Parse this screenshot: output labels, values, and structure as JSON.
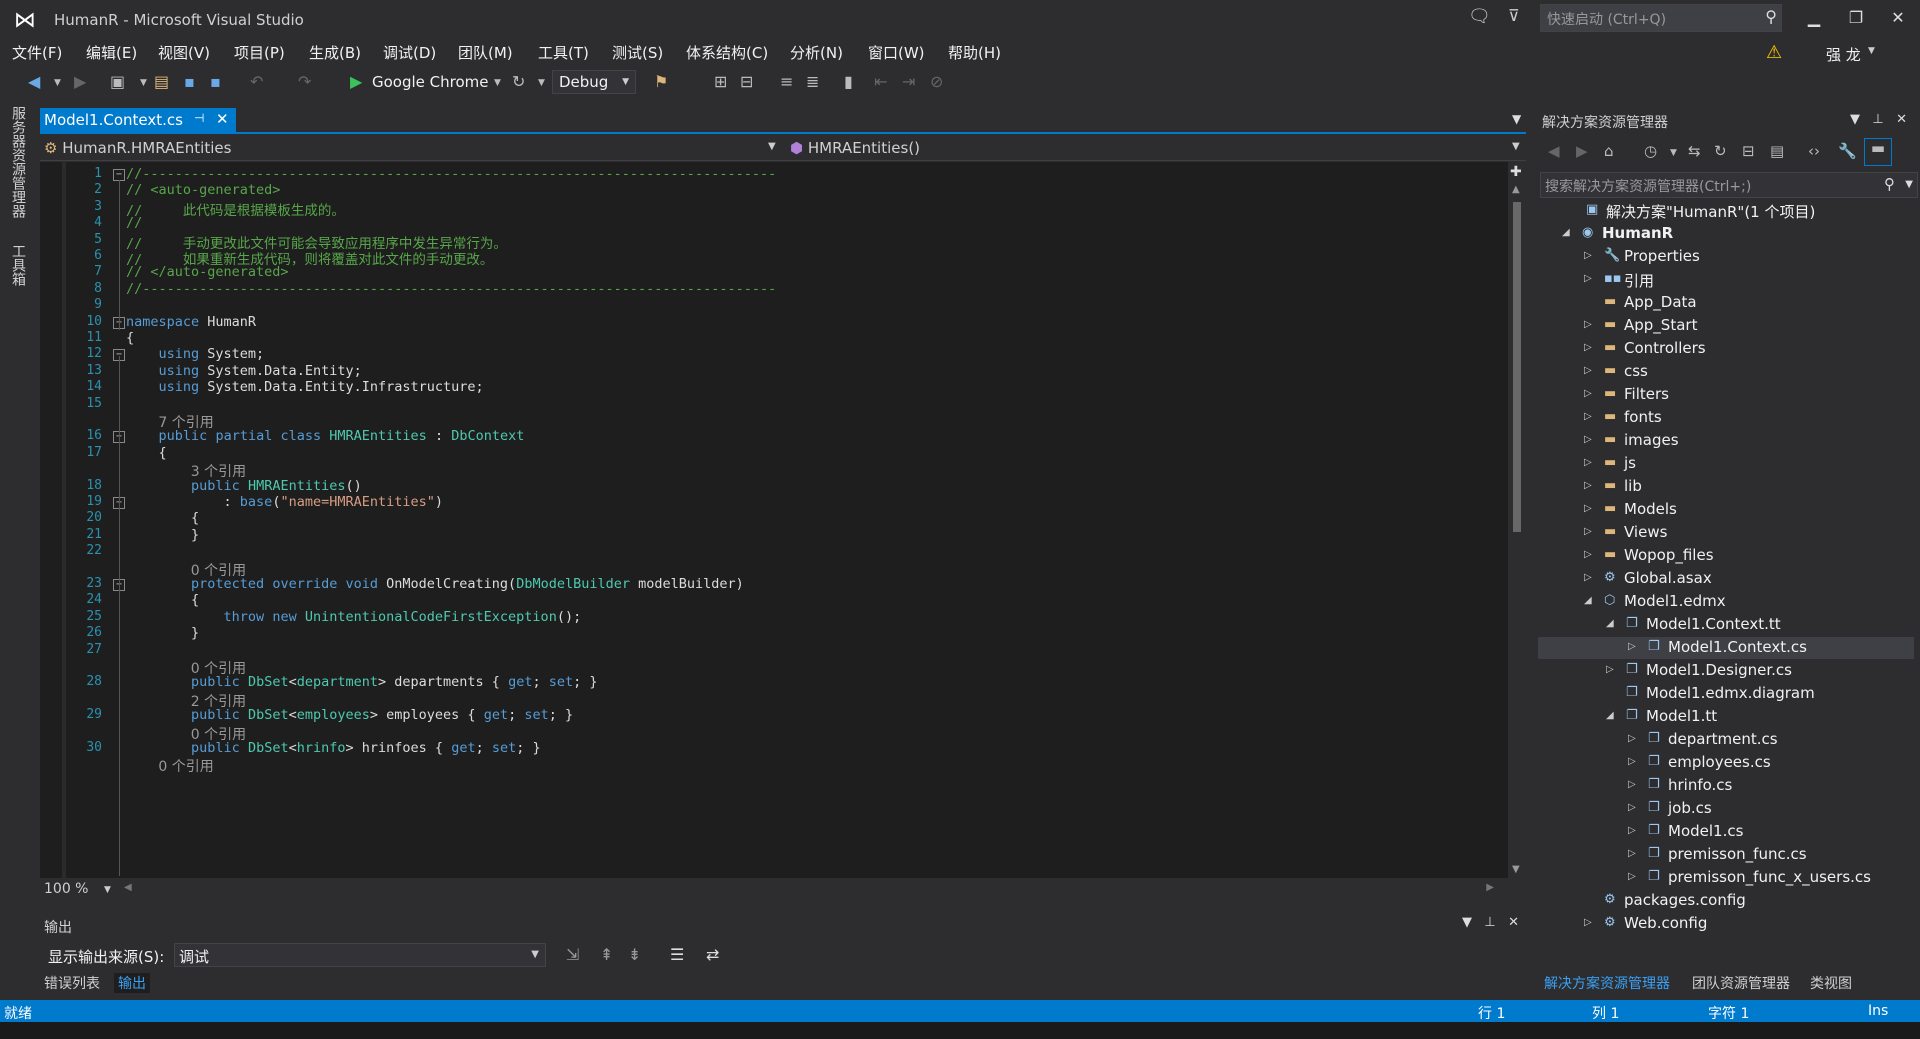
{
  "window": {
    "title": "HumanR - Microsoft Visual Studio",
    "quick_launch_placeholder": "快速启动 (Ctrl+Q)",
    "user": "强 龙"
  },
  "menu": [
    "文件(F)",
    "编辑(E)",
    "视图(V)",
    "项目(P)",
    "生成(B)",
    "调试(D)",
    "团队(M)",
    "工具(T)",
    "测试(S)",
    "体系结构(C)",
    "分析(N)",
    "窗口(W)",
    "帮助(H)"
  ],
  "toolbar": {
    "browser": "Google Chrome",
    "configuration": "Debug"
  },
  "left_tabs": [
    "服务器资源管理器",
    "工具箱"
  ],
  "editor": {
    "tab": "Model1.Context.cs",
    "nav_left": "HumanR.HMRAEntities",
    "nav_right": "HMRAEntities()",
    "zoom": "100 %",
    "code_lines": [
      {
        "n": "1",
        "t": "//------------------------------------------------------------------------------"
      },
      {
        "n": "2",
        "t": "// <auto-generated>"
      },
      {
        "n": "3",
        "t": "//     此代码是根据模板生成的。"
      },
      {
        "n": "4",
        "t": "//"
      },
      {
        "n": "5",
        "t": "//     手动更改此文件可能会导致应用程序中发生异常行为。"
      },
      {
        "n": "6",
        "t": "//     如果重新生成代码，则将覆盖对此文件的手动更改。"
      },
      {
        "n": "7",
        "t": "// </auto-generated>"
      },
      {
        "n": "8",
        "t": "//------------------------------------------------------------------------------"
      },
      {
        "n": "9",
        "t": ""
      },
      {
        "n": "10",
        "t": "namespace HumanR"
      },
      {
        "n": "11",
        "t": "{"
      },
      {
        "n": "12",
        "t": "    using System;"
      },
      {
        "n": "13",
        "t": "    using System.Data.Entity;"
      },
      {
        "n": "14",
        "t": "    using System.Data.Entity.Infrastructure;"
      },
      {
        "n": "15",
        "t": ""
      },
      {
        "lens": "7 个引用"
      },
      {
        "n": "16",
        "t": "    public partial class HMRAEntities : DbContext"
      },
      {
        "n": "17",
        "t": "    {"
      },
      {
        "lens": "3 个引用"
      },
      {
        "n": "18",
        "t": "        public HMRAEntities()"
      },
      {
        "n": "19",
        "t": "            : base(\"name=HMRAEntities\")"
      },
      {
        "n": "20",
        "t": "        {"
      },
      {
        "n": "21",
        "t": "        }"
      },
      {
        "n": "22",
        "t": ""
      },
      {
        "lens": "0 个引用"
      },
      {
        "n": "23",
        "t": "        protected override void OnModelCreating(DbModelBuilder modelBuilder)"
      },
      {
        "n": "24",
        "t": "        {"
      },
      {
        "n": "25",
        "t": "            throw new UnintentionalCodeFirstException();"
      },
      {
        "n": "26",
        "t": "        }"
      },
      {
        "n": "27",
        "t": ""
      },
      {
        "lens": "0 个引用"
      },
      {
        "n": "28",
        "t": "        public DbSet<department> departments { get; set; }"
      },
      {
        "lens": "2 个引用"
      },
      {
        "n": "29",
        "t": "        public DbSet<employees> employees { get; set; }"
      },
      {
        "lens": "0 个引用"
      },
      {
        "n": "30",
        "t": "        public DbSet<hrinfo> hrinfoes { get; set; }"
      },
      {
        "lens": "0 个引用"
      }
    ]
  },
  "output": {
    "title": "输出",
    "source_label": "显示输出来源(S):",
    "source_value": "调试",
    "tabs": [
      "错误列表",
      "输出"
    ]
  },
  "solution_explorer": {
    "title": "解决方案资源管理器",
    "search_placeholder": "搜索解决方案资源管理器(Ctrl+;)",
    "tree": [
      {
        "label": "解决方案\"HumanR\"(1 个项目)",
        "depth": 0,
        "expand": "",
        "icon": "solution-icon"
      },
      {
        "label": "HumanR",
        "depth": 0,
        "expand": "open",
        "icon": "project-icon"
      },
      {
        "label": "Properties",
        "depth": 1,
        "expand": "closed",
        "icon": "wrench-icon"
      },
      {
        "label": "引用",
        "depth": 1,
        "expand": "closed",
        "icon": "references-icon"
      },
      {
        "label": "App_Data",
        "depth": 1,
        "expand": "",
        "icon": "folder-icon"
      },
      {
        "label": "App_Start",
        "depth": 1,
        "expand": "closed",
        "icon": "folder-icon"
      },
      {
        "label": "Controllers",
        "depth": 1,
        "expand": "closed",
        "icon": "folder-icon"
      },
      {
        "label": "css",
        "depth": 1,
        "expand": "closed",
        "icon": "folder-icon"
      },
      {
        "label": "Filters",
        "depth": 1,
        "expand": "closed",
        "icon": "folder-icon"
      },
      {
        "label": "fonts",
        "depth": 1,
        "expand": "closed",
        "icon": "folder-icon"
      },
      {
        "label": "images",
        "depth": 1,
        "expand": "closed",
        "icon": "folder-icon"
      },
      {
        "label": "js",
        "depth": 1,
        "expand": "closed",
        "icon": "folder-icon"
      },
      {
        "label": "lib",
        "depth": 1,
        "expand": "closed",
        "icon": "folder-icon"
      },
      {
        "label": "Models",
        "depth": 1,
        "expand": "closed",
        "icon": "folder-icon"
      },
      {
        "label": "Views",
        "depth": 1,
        "expand": "closed",
        "icon": "folder-icon"
      },
      {
        "label": "Wopop_files",
        "depth": 1,
        "expand": "closed",
        "icon": "folder-icon"
      },
      {
        "label": "Global.asax",
        "depth": 1,
        "expand": "closed",
        "icon": "gear-file-icon"
      },
      {
        "label": "Model1.edmx",
        "depth": 1,
        "expand": "open",
        "icon": "edmx-icon"
      },
      {
        "label": "Model1.Context.tt",
        "depth": 2,
        "expand": "open",
        "icon": "file-icon"
      },
      {
        "label": "Model1.Context.cs",
        "depth": 3,
        "expand": "closed",
        "icon": "file-icon",
        "selected": true
      },
      {
        "label": "Model1.Designer.cs",
        "depth": 2,
        "expand": "closed",
        "icon": "file-icon"
      },
      {
        "label": "Model1.edmx.diagram",
        "depth": 2,
        "expand": "",
        "icon": "file-icon"
      },
      {
        "label": "Model1.tt",
        "depth": 2,
        "expand": "open",
        "icon": "file-icon"
      },
      {
        "label": "department.cs",
        "depth": 3,
        "expand": "closed",
        "icon": "file-icon"
      },
      {
        "label": "employees.cs",
        "depth": 3,
        "expand": "closed",
        "icon": "file-icon"
      },
      {
        "label": "hrinfo.cs",
        "depth": 3,
        "expand": "closed",
        "icon": "file-icon"
      },
      {
        "label": "job.cs",
        "depth": 3,
        "expand": "closed",
        "icon": "file-icon"
      },
      {
        "label": "Model1.cs",
        "depth": 3,
        "expand": "closed",
        "icon": "file-icon"
      },
      {
        "label": "premisson_func.cs",
        "depth": 3,
        "expand": "closed",
        "icon": "file-icon"
      },
      {
        "label": "premisson_func_x_users.cs",
        "depth": 3,
        "expand": "closed",
        "icon": "file-icon"
      },
      {
        "label": "packages.config",
        "depth": 1,
        "expand": "",
        "icon": "config-icon"
      },
      {
        "label": "Web.config",
        "depth": 1,
        "expand": "closed",
        "icon": "config-icon"
      }
    ],
    "tabs": [
      "解决方案资源管理器",
      "团队资源管理器",
      "类视图"
    ]
  },
  "status": {
    "ready": "就绪",
    "line": "行 1",
    "col": "列 1",
    "char": "字符 1",
    "mode": "Ins"
  },
  "colors": {
    "accent": "#007acc",
    "editor_bg": "#1e1e1e",
    "chrome_bg": "#2d2d30",
    "comment": "#57a64a",
    "keyword": "#569cd6",
    "type": "#4ec9b0",
    "string": "#d69d85"
  }
}
